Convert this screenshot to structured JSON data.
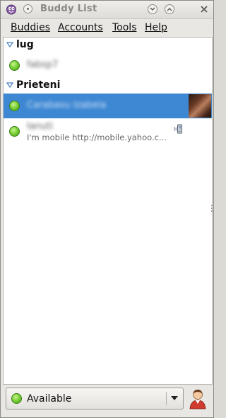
{
  "window": {
    "title": "Buddy List"
  },
  "menubar": {
    "items": [
      "Buddies",
      "Accounts",
      "Tools",
      "Help"
    ]
  },
  "groups": [
    {
      "name": "lug",
      "buddies": [
        {
          "name": "fabsp7",
          "status": "",
          "selected": false
        }
      ]
    },
    {
      "name": "Prieteni",
      "buddies": [
        {
          "name": "Carabasu Izabela",
          "status": "",
          "selected": true
        },
        {
          "name": "Ianuti",
          "status": "I'm mobile http://mobile.yahoo.c...",
          "selected": false
        }
      ]
    }
  ],
  "status_selector": {
    "label": "Available",
    "color": "#5fbf25"
  },
  "colors": {
    "selection": "#3d87d3",
    "online": "#5fbf25"
  }
}
